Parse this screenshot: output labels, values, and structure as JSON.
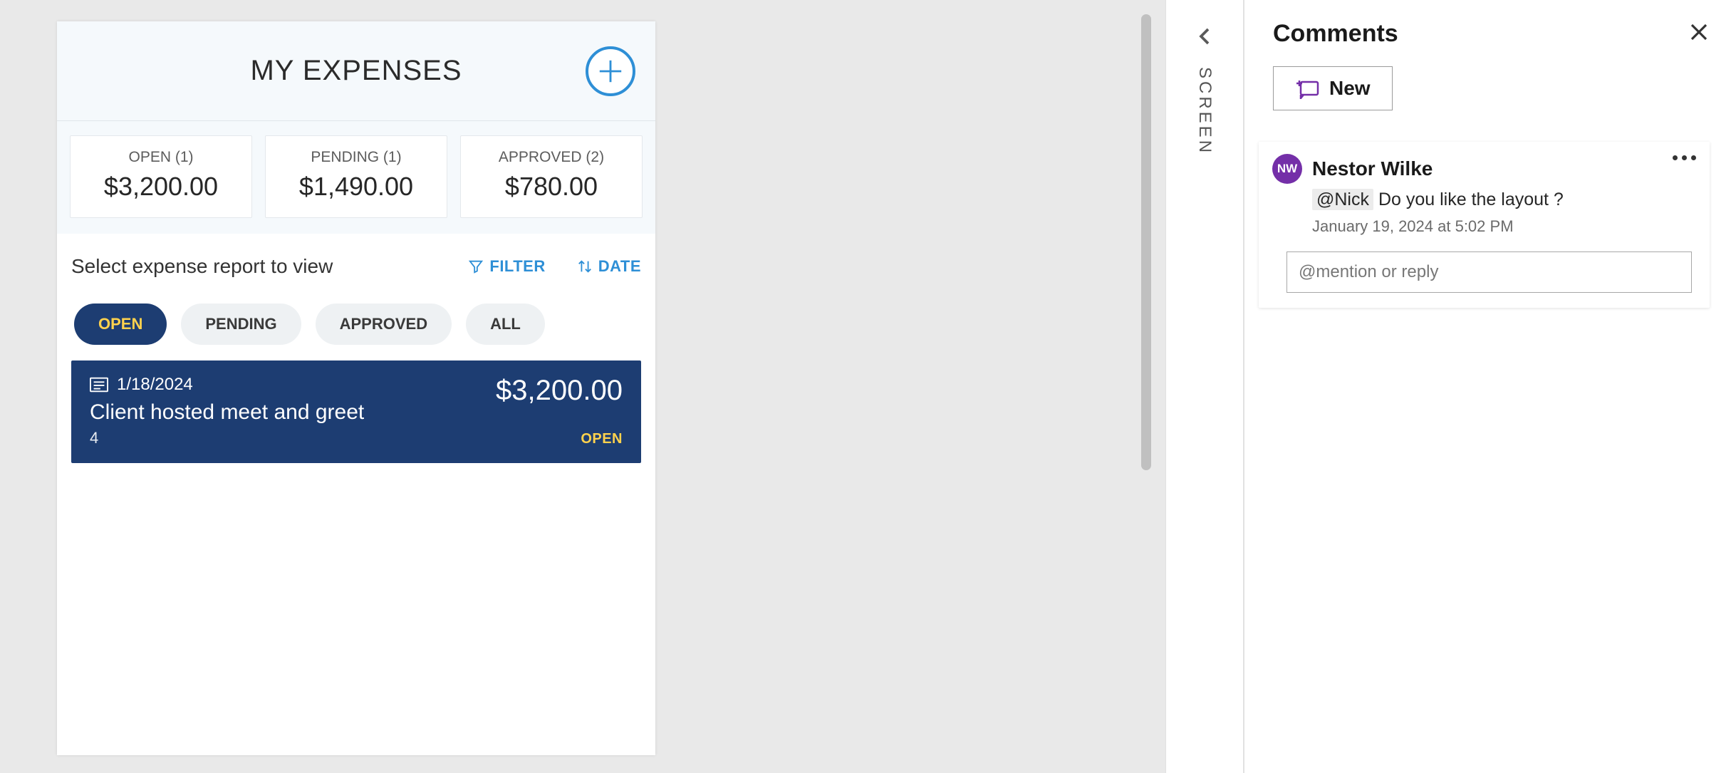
{
  "app": {
    "title": "MY EXPENSES",
    "stats": [
      {
        "label": "OPEN (1)",
        "value": "$3,200.00"
      },
      {
        "label": "PENDING (1)",
        "value": "$1,490.00"
      },
      {
        "label": "APPROVED (2)",
        "value": "$780.00"
      }
    ],
    "list_title": "Select expense report to view",
    "tools": {
      "filter": "FILTER",
      "date": "DATE"
    },
    "tabs": [
      "OPEN",
      "PENDING",
      "APPROVED",
      "ALL"
    ],
    "active_tab": 0,
    "expense": {
      "date": "1/18/2024",
      "title": "Client hosted meet and greet",
      "sub": "4",
      "amount": "$3,200.00",
      "status": "OPEN"
    }
  },
  "side_tab": {
    "label": "SCREEN"
  },
  "comments": {
    "title": "Comments",
    "new_label": "New",
    "thread": {
      "avatar_initials": "NW",
      "author": "Nestor Wilke",
      "mention": "@Nick",
      "text": "Do you like the layout ?",
      "timestamp": "January 19, 2024 at 5:02 PM",
      "reply_placeholder": "@mention or reply"
    }
  }
}
